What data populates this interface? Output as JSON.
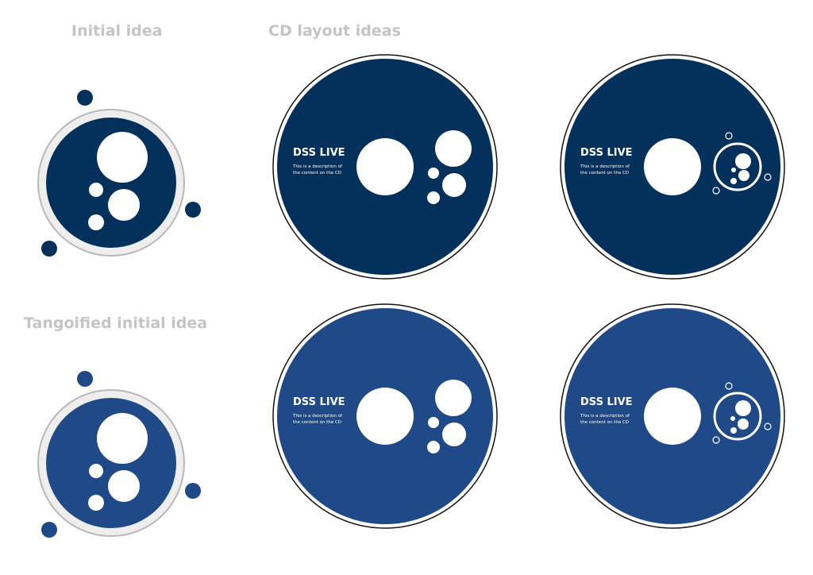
{
  "headings": {
    "initial": "Initial idea",
    "cd_layouts": "CD layout ideas",
    "tangoified": "Tangoified initial idea"
  },
  "cd_label": {
    "title": "DSS LIVE",
    "description_line1": "This is a description of",
    "description_line2": "the content on the CD"
  },
  "colors": {
    "dark_navy": "#04315c",
    "tango_blue": "#204a87",
    "ring_gray": "#b8b8b8",
    "ring_fill": "#eeeeee",
    "heading_gray": "#c4c4c4"
  }
}
